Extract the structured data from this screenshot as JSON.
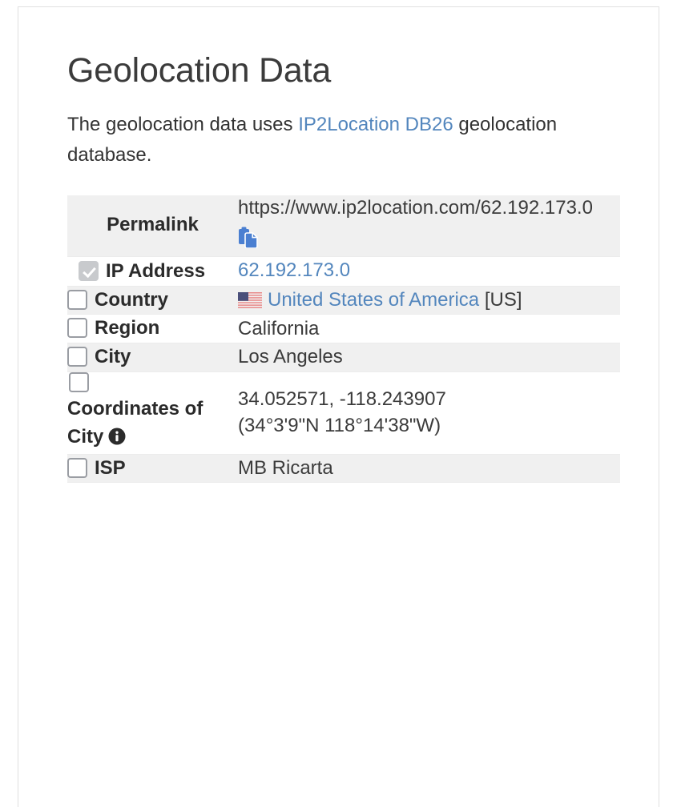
{
  "page": {
    "title": "Geolocation Data",
    "intro_prefix": "The geolocation data uses ",
    "intro_link": "IP2Location DB26",
    "intro_suffix": " geolocation database."
  },
  "colors": {
    "link": "#5386bd",
    "text": "#3b3b3b",
    "row_shaded": "#f0f0f0",
    "copy_icon": "#4a7fd1",
    "checkbox_border": "#9a9da3",
    "checkbox_checked_fill": "#c8cacd"
  },
  "table": {
    "rows": [
      {
        "name": "permalink",
        "label": "Permalink",
        "checkbox": null,
        "value": "https://www.ip2location.com/62.192.173.0",
        "value_type": "text-with-copy",
        "copy_icon": "copy-icon",
        "shaded": true
      },
      {
        "name": "ip-address",
        "label": "IP Address",
        "checkbox": "checked",
        "value": "62.192.173.0",
        "value_type": "link",
        "shaded": false
      },
      {
        "name": "country",
        "label": "Country",
        "checkbox": "unchecked",
        "value": "United States of America",
        "value_suffix": "[US]",
        "flag_icon": "us-flag-icon",
        "value_type": "link-with-flag",
        "shaded": true
      },
      {
        "name": "region",
        "label": "Region",
        "checkbox": "unchecked",
        "value": "California",
        "value_type": "text",
        "shaded": false
      },
      {
        "name": "city",
        "label": "City",
        "checkbox": "unchecked",
        "value": "Los Angeles",
        "value_type": "text",
        "shaded": true
      },
      {
        "name": "coordinates-of-city",
        "label": "Coordinates of City",
        "checkbox": "unchecked",
        "info_icon": "info-icon",
        "value_decimal": "34.052571, -118.243907",
        "value_dms": "(34°3'9\"N   118°14'38\"W)",
        "value_type": "coordinates",
        "shaded": false
      },
      {
        "name": "isp",
        "label": "ISP",
        "checkbox": "unchecked",
        "value": "MB Ricarta",
        "value_type": "text",
        "shaded": true
      }
    ]
  }
}
